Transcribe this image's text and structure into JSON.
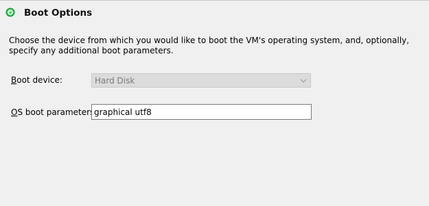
{
  "section": {
    "title": "Boot Options",
    "status_icon": "green-status-icon",
    "description": "Choose the device from which you would like to boot the VM's operating system, and, optionally, specify any additional boot parameters."
  },
  "boot_device": {
    "label_mnemonic": "B",
    "label_rest": "oot device:",
    "value": "Hard Disk",
    "disabled": true
  },
  "os_boot_parameters": {
    "label_mnemonic": "O",
    "label_rest": "S boot parameters:",
    "value": "graphical utf8"
  },
  "colors": {
    "status_green": "#2bb24c",
    "background": "#f0f0f0"
  }
}
